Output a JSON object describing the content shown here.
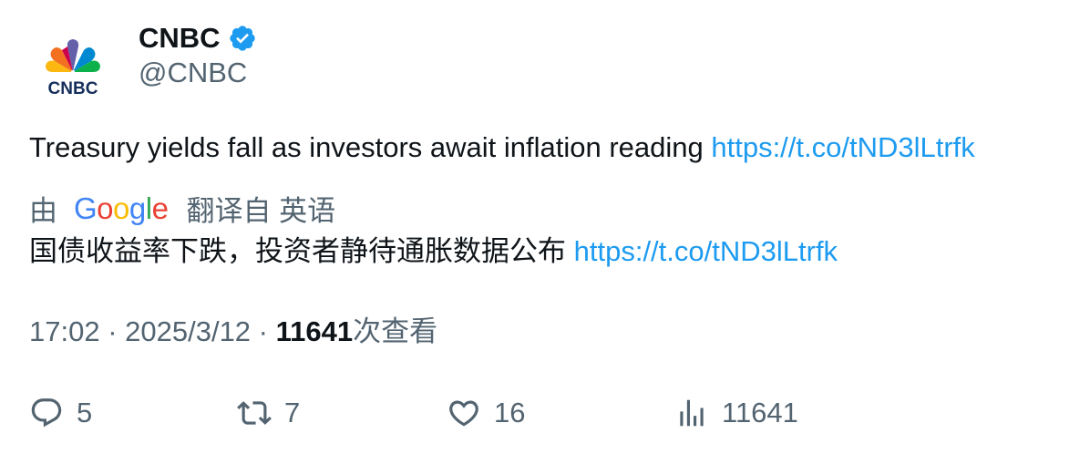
{
  "author": {
    "display_name": "CNBC",
    "handle": "@CNBC",
    "verified_icon": "verified-badge-icon",
    "logo_text": "CNBC"
  },
  "tweet": {
    "text": "Treasury yields fall as investors await inflation reading ",
    "link": "https://t.co/tND3lLtrfk"
  },
  "translation": {
    "by_label": "由",
    "provider_letters": [
      "G",
      "o",
      "o",
      "g",
      "l",
      "e"
    ],
    "from_label": "翻译自 英语",
    "text": "国债收益率下跌，投资者静待通胀数据公布 ",
    "link": "https://t.co/tND3lLtrfk"
  },
  "meta": {
    "time": "17:02",
    "separator": " · ",
    "date": "2025/3/12",
    "views_count": "11641",
    "views_label": "次查看"
  },
  "actions": {
    "replies": "5",
    "retweets": "7",
    "likes": "16",
    "views": "11641"
  },
  "colors": {
    "link": "#1d9bf0",
    "secondary_text": "#536471",
    "primary_text": "#0f1419",
    "verified": "#1d9bf0",
    "google_blue": "#4285f4",
    "google_red": "#ea4335",
    "google_yellow": "#fbbc05",
    "google_green": "#34a853"
  }
}
